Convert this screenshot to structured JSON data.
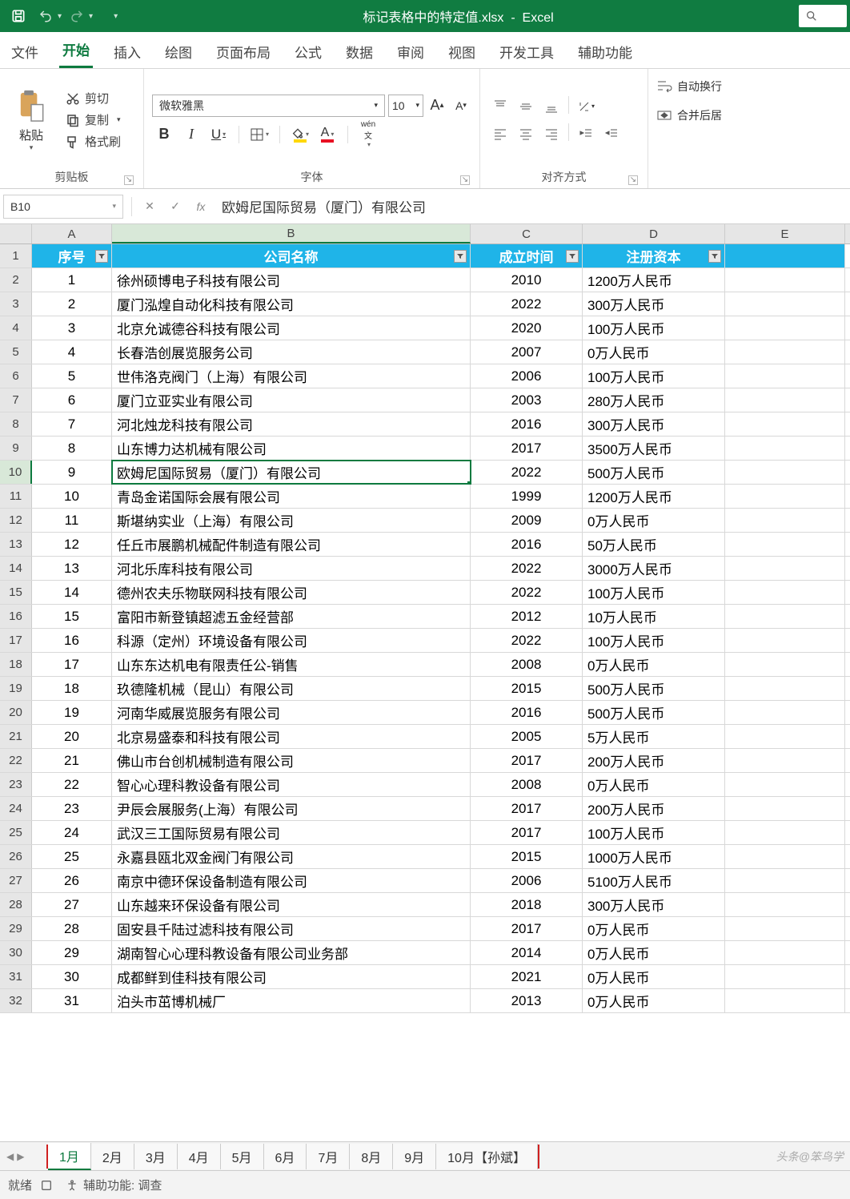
{
  "titlebar": {
    "filename": "标记表格中的特定值.xlsx",
    "app": "Excel"
  },
  "tabs": {
    "file": "文件",
    "home": "开始",
    "insert": "插入",
    "draw": "绘图",
    "pagelayout": "页面布局",
    "formulas": "公式",
    "data": "数据",
    "review": "审阅",
    "view": "视图",
    "developer": "开发工具",
    "help": "辅助功能"
  },
  "ribbon": {
    "clipboard": {
      "paste": "粘贴",
      "cut": "剪切",
      "copy": "复制",
      "formatpainter": "格式刷",
      "label": "剪贴板"
    },
    "font": {
      "name": "微软雅黑",
      "size": "10",
      "wen_label": "wén",
      "wen_sub": "文",
      "label": "字体"
    },
    "align": {
      "wrap": "自动换行",
      "merge": "合并后居",
      "label": "对齐方式"
    }
  },
  "formula_bar": {
    "cell_ref": "B10",
    "value": "欧姆尼国际贸易（厦门）有限公司"
  },
  "columns": [
    "A",
    "B",
    "C",
    "D",
    "E"
  ],
  "table": {
    "headers": {
      "a": "序号",
      "b": "公司名称",
      "c": "成立时间",
      "d": "注册资本"
    },
    "rows": [
      {
        "n": "1",
        "name": "徐州硕博电子科技有限公司",
        "y": "2010",
        "cap": "1200万人民币"
      },
      {
        "n": "2",
        "name": "厦门泓煌自动化科技有限公司",
        "y": "2022",
        "cap": "300万人民币"
      },
      {
        "n": "3",
        "name": "北京允诚德谷科技有限公司",
        "y": "2020",
        "cap": "100万人民币"
      },
      {
        "n": "4",
        "name": "长春浩创展览服务公司",
        "y": "2007",
        "cap": "0万人民币"
      },
      {
        "n": "5",
        "name": "世伟洛克阀门（上海）有限公司",
        "y": "2006",
        "cap": "100万人民币"
      },
      {
        "n": "6",
        "name": "厦门立亚实业有限公司",
        "y": "2003",
        "cap": "280万人民币"
      },
      {
        "n": "7",
        "name": "河北烛龙科技有限公司",
        "y": "2016",
        "cap": "300万人民币"
      },
      {
        "n": "8",
        "name": "山东博力达机械有限公司",
        "y": "2017",
        "cap": "3500万人民币"
      },
      {
        "n": "9",
        "name": "欧姆尼国际贸易（厦门）有限公司",
        "y": "2022",
        "cap": "500万人民币"
      },
      {
        "n": "10",
        "name": "青岛金诺国际会展有限公司",
        "y": "1999",
        "cap": "1200万人民币"
      },
      {
        "n": "11",
        "name": "斯堪纳实业（上海）有限公司",
        "y": "2009",
        "cap": "0万人民币"
      },
      {
        "n": "12",
        "name": "任丘市展鹏机械配件制造有限公司",
        "y": "2016",
        "cap": "50万人民币"
      },
      {
        "n": "13",
        "name": "河北乐库科技有限公司",
        "y": "2022",
        "cap": "3000万人民币"
      },
      {
        "n": "14",
        "name": "德州农夫乐物联网科技有限公司",
        "y": "2022",
        "cap": "100万人民币"
      },
      {
        "n": "15",
        "name": "富阳市新登镇超滤五金经营部",
        "y": "2012",
        "cap": "10万人民币"
      },
      {
        "n": "16",
        "name": "科源（定州）环境设备有限公司",
        "y": "2022",
        "cap": "100万人民币"
      },
      {
        "n": "17",
        "name": "山东东达机电有限责任公-销售",
        "y": "2008",
        "cap": "0万人民币"
      },
      {
        "n": "18",
        "name": "玖德隆机械（昆山）有限公司",
        "y": "2015",
        "cap": "500万人民币"
      },
      {
        "n": "19",
        "name": "河南华威展览服务有限公司",
        "y": "2016",
        "cap": "500万人民币"
      },
      {
        "n": "20",
        "name": "北京易盛泰和科技有限公司",
        "y": "2005",
        "cap": "5万人民币"
      },
      {
        "n": "21",
        "name": "佛山市台创机械制造有限公司",
        "y": "2017",
        "cap": "200万人民币"
      },
      {
        "n": "22",
        "name": "智心心理科教设备有限公司",
        "y": "2008",
        "cap": "0万人民币"
      },
      {
        "n": "23",
        "name": "尹辰会展服务(上海）有限公司",
        "y": "2017",
        "cap": "200万人民币"
      },
      {
        "n": "24",
        "name": "武汉三工国际贸易有限公司",
        "y": "2017",
        "cap": "100万人民币"
      },
      {
        "n": "25",
        "name": "永嘉县瓯北双金阀门有限公司",
        "y": "2015",
        "cap": "1000万人民币"
      },
      {
        "n": "26",
        "name": "南京中德环保设备制造有限公司",
        "y": "2006",
        "cap": "5100万人民币"
      },
      {
        "n": "27",
        "name": "山东越来环保设备有限公司",
        "y": "2018",
        "cap": "300万人民币"
      },
      {
        "n": "28",
        "name": "固安县千陆过滤科技有限公司",
        "y": "2017",
        "cap": "0万人民币"
      },
      {
        "n": "29",
        "name": "湖南智心心理科教设备有限公司业务部",
        "y": "2014",
        "cap": "0万人民币"
      },
      {
        "n": "30",
        "name": "成都鲜到佳科技有限公司",
        "y": "2021",
        "cap": "0万人民币"
      },
      {
        "n": "31",
        "name": "泊头市茁博机械厂",
        "y": "2013",
        "cap": "0万人民币"
      }
    ]
  },
  "sheets": [
    "1月",
    "2月",
    "3月",
    "4月",
    "5月",
    "6月",
    "7月",
    "8月",
    "9月",
    "10月【孙斌】"
  ],
  "watermark": "头条@笨鸟学",
  "status": {
    "ready": "就绪",
    "acc": "辅助功能: 调查"
  }
}
